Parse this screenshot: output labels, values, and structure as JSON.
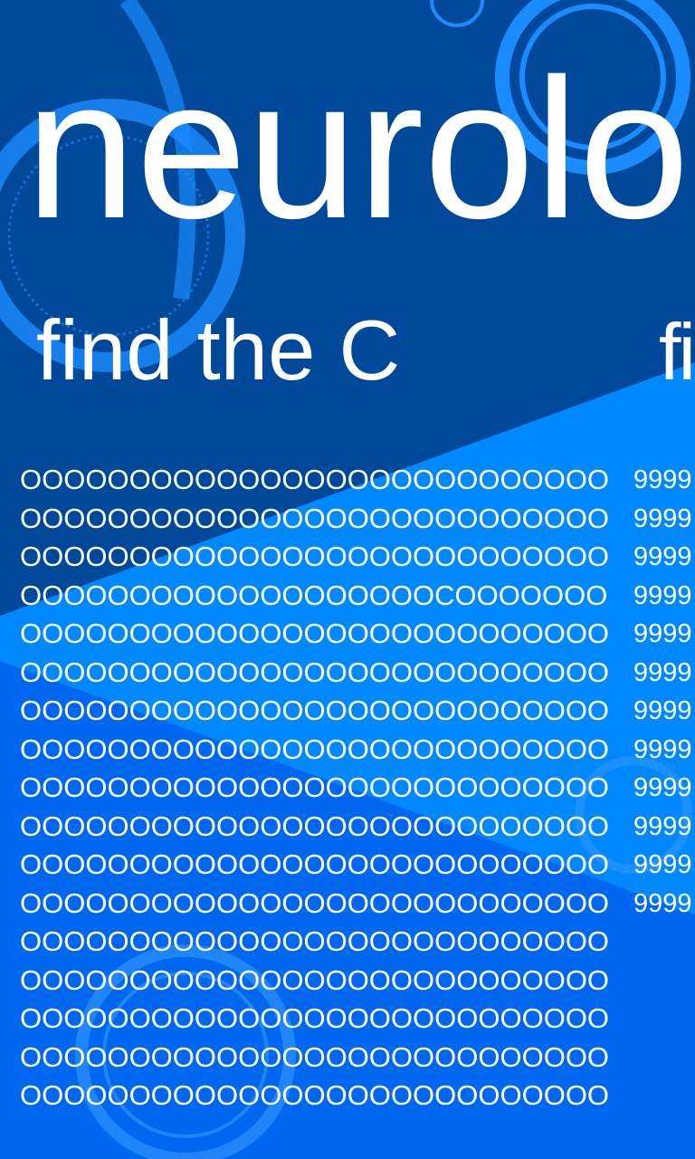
{
  "app": {
    "title": "neurolo"
  },
  "panels": [
    {
      "header": "find the C",
      "rows": [
        "OOOOOOOOOOOOOOOOOOOOOOOOOOO",
        "OOOOOOOOOOOOOOOOOOOOOOOOOOO",
        "OOOOOOOOOOOOOOOOOOOOOOOOOOO",
        "OOOOOOOOOOOOOOOOOOOCOOOOOOO",
        "OOOOOOOOOOOOOOOOOOOOOOOOOOO",
        "OOOOOOOOOOOOOOOOOOOOOOOOOOO",
        "OOOOOOOOOOOOOOOOOOOOOOOOOOO",
        "OOOOOOOOOOOOOOOOOOOOOOOOOOO",
        "OOOOOOOOOOOOOOOOOOOOOOOOOOO",
        "OOOOOOOOOOOOOOOOOOOOOOOOOOO",
        "OOOOOOOOOOOOOOOOOOOOOOOOOOO",
        "OOOOOOOOOOOOOOOOOOOOOOOOOOO",
        "OOOOOOOOOOOOOOOOOOOOOOOOOOO",
        "OOOOOOOOOOOOOOOOOOOOOOOOOOO",
        "OOOOOOOOOOOOOOOOOOOOOOOOOOO",
        "OOOOOOOOOOOOOOOOOOOOOOOOOOO",
        "OOOOOOOOOOOOOOOOOOOOOOOOOOO"
      ]
    },
    {
      "header": "fi",
      "rows": [
        "9999",
        "9999",
        "9999",
        "9999",
        "9999",
        "9999",
        "9999",
        "9999",
        "9999",
        "9999",
        "9999",
        "9999"
      ]
    }
  ],
  "colors": {
    "dark": "#00489a",
    "band": "#0088ff",
    "bottom": "#0068f0",
    "text": "#ffffff"
  }
}
